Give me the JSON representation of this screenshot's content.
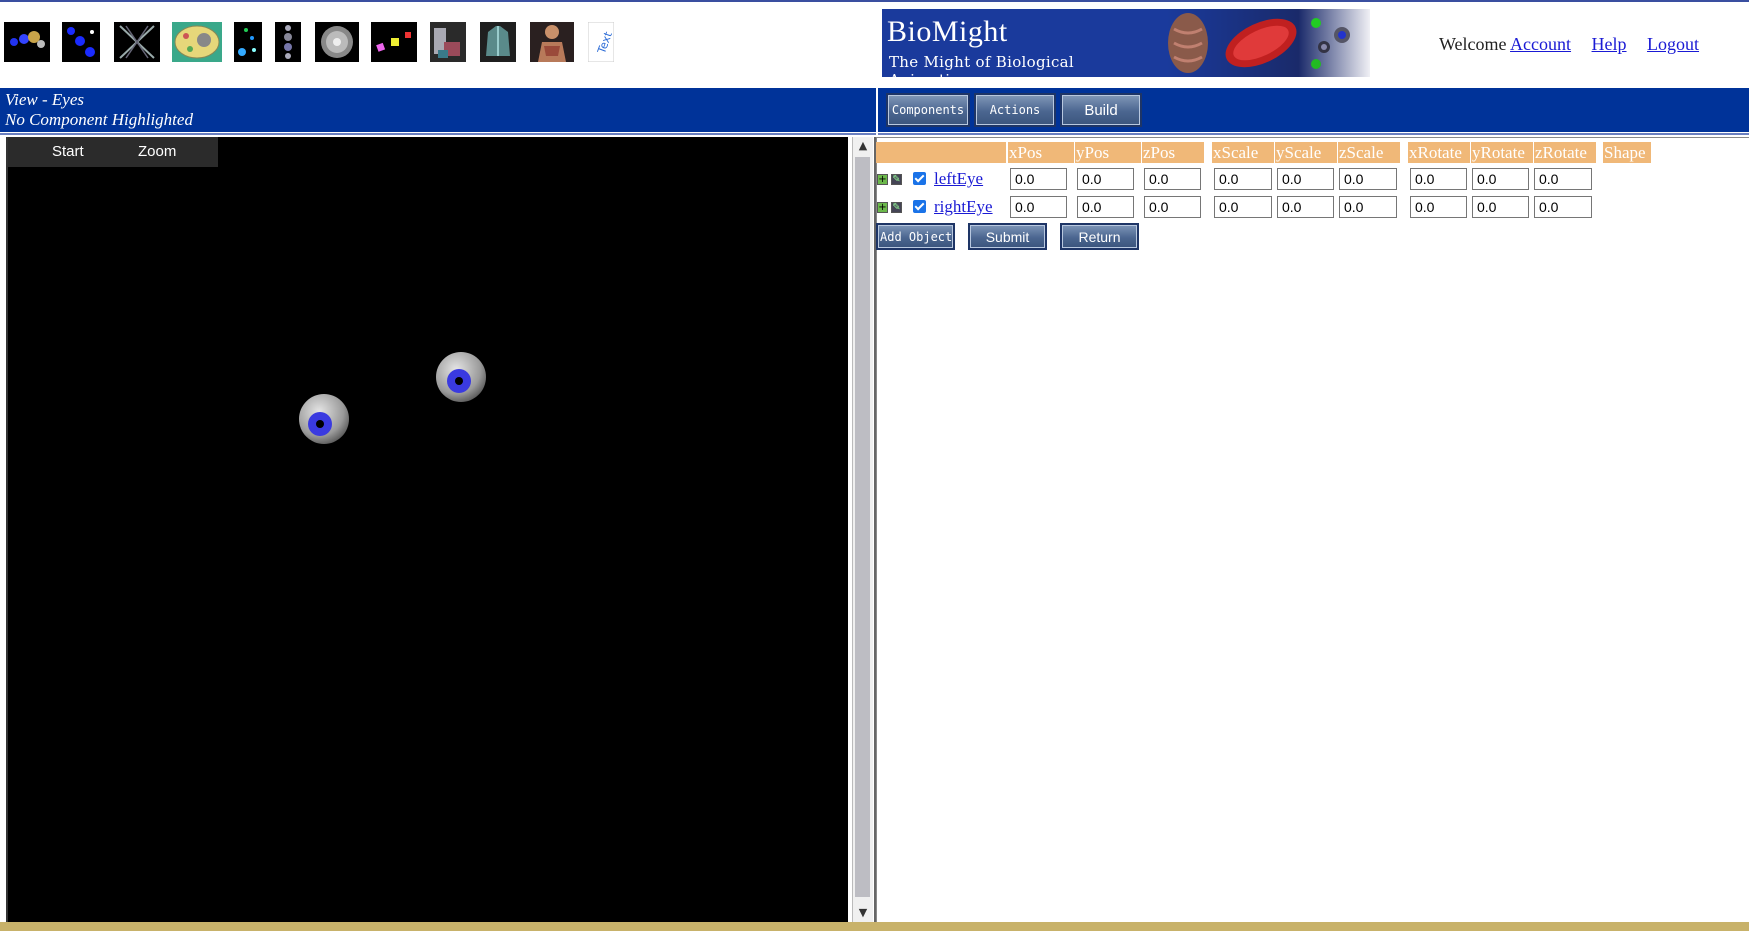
{
  "banner": {
    "title": "BioMight",
    "tagline": "The Might of Biological Animations"
  },
  "user_links": {
    "welcome": "Welcome",
    "account": "Account",
    "help": "Help",
    "logout": "Logout"
  },
  "thumbnails": [
    {
      "name": "atom-thumbnail"
    },
    {
      "name": "molecule-thumbnail"
    },
    {
      "name": "dna-helix-thumbnail"
    },
    {
      "name": "cell-thumbnail"
    },
    {
      "name": "particles-thumbnail"
    },
    {
      "name": "chain-thumbnail"
    },
    {
      "name": "sphere-thumbnail"
    },
    {
      "name": "blocks-thumbnail"
    },
    {
      "name": "tissue-thumbnail"
    },
    {
      "name": "organ-thumbnail"
    },
    {
      "name": "human-body-thumbnail"
    },
    {
      "name": "text-thumbnail",
      "label": "Text"
    }
  ],
  "view": {
    "title": "View - Eyes",
    "status": "No Component Highlighted"
  },
  "toolbar": {
    "components": "Components",
    "actions": "Actions",
    "build": "Build"
  },
  "viewer": {
    "start": "Start",
    "zoom": "Zoom"
  },
  "table": {
    "headers": [
      "xPos",
      "yPos",
      "zPos",
      "xScale",
      "yScale",
      "zScale",
      "xRotate",
      "yRotate",
      "zRotate",
      "Shape"
    ],
    "rows": [
      {
        "name": "leftEye",
        "checked": true,
        "values": [
          "0.0",
          "0.0",
          "0.0",
          "0.0",
          "0.0",
          "0.0",
          "0.0",
          "0.0",
          "0.0"
        ]
      },
      {
        "name": "rightEye",
        "checked": true,
        "values": [
          "0.0",
          "0.0",
          "0.0",
          "0.0",
          "0.0",
          "0.0",
          "0.0",
          "0.0",
          "0.0"
        ]
      }
    ]
  },
  "actions": {
    "add_object": "Add Object",
    "submit": "Submit",
    "return": "Return"
  },
  "colors": {
    "nav_blue": "#003399",
    "header_orange": "#f0b878",
    "link_blue": "#1a1ad4"
  }
}
